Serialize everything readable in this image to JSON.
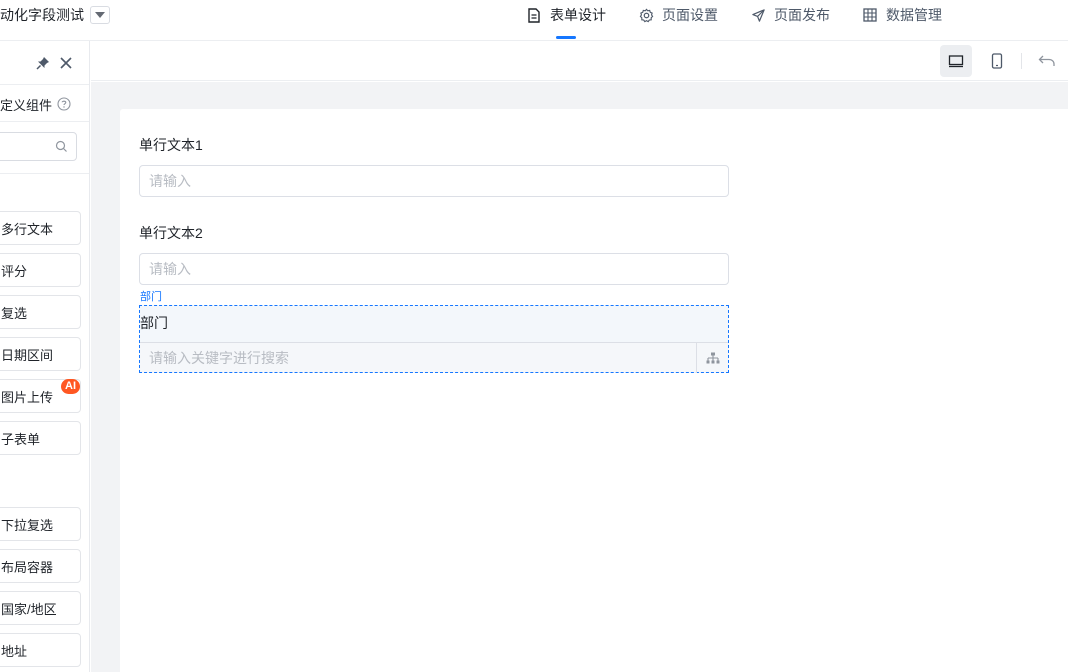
{
  "header": {
    "app_title": "动化字段测试",
    "tabs": [
      {
        "label": "表单设计",
        "icon": "document-icon",
        "active": true
      },
      {
        "label": "页面设置",
        "icon": "gear-icon",
        "active": false
      },
      {
        "label": "页面发布",
        "icon": "send-icon",
        "active": false
      },
      {
        "label": "数据管理",
        "icon": "table-icon",
        "active": false
      }
    ]
  },
  "left_panel": {
    "custom_components_label": "定义组件",
    "search": {
      "value": "",
      "placeholder": ""
    },
    "components_group1": [
      "多行文本",
      "评分",
      "复选",
      "日期区间",
      "图片上传",
      "子表单"
    ],
    "ai_badge": "AI",
    "components_group2": [
      "下拉复选",
      "布局容器",
      "国家/地区",
      "地址"
    ]
  },
  "form": {
    "fields": [
      {
        "label": "单行文本1",
        "placeholder": "请输入"
      },
      {
        "label": "单行文本2",
        "placeholder": "请输入"
      }
    ],
    "selected_field": {
      "tag": "部门",
      "label": "部门",
      "placeholder": "请输入关键字进行搜索",
      "icon": "org-tree-icon"
    }
  },
  "colors": {
    "accent": "#1677ff",
    "ai_badge": "#ff5722",
    "canvas_bg": "#f2f3f5"
  }
}
